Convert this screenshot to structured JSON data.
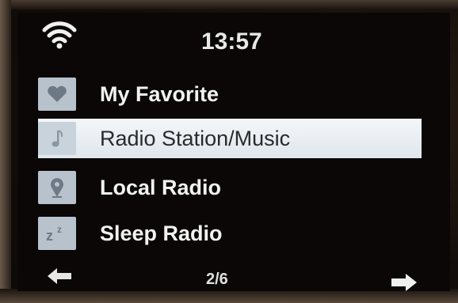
{
  "status": {
    "time": "13:57",
    "wifi_icon": "wifi-icon"
  },
  "menu": {
    "items": [
      {
        "label": "My Favorite",
        "icon": "heart-icon",
        "selected": false
      },
      {
        "label": "Radio Station/Music",
        "icon": "music-note-icon",
        "selected": true
      },
      {
        "label": "Local Radio",
        "icon": "location-pin-icon",
        "selected": false
      },
      {
        "label": "Sleep Radio",
        "icon": "sleep-zzz-icon",
        "selected": false
      }
    ]
  },
  "footer": {
    "page_indicator": "2/6",
    "prev_icon": "arrow-left-icon",
    "next_icon": "arrow-right-icon"
  },
  "colors": {
    "highlight": "#e8eef3",
    "icon_tile": "#b8c2cc",
    "text": "#f2f2f2",
    "screen_bg": "#0a0706"
  }
}
